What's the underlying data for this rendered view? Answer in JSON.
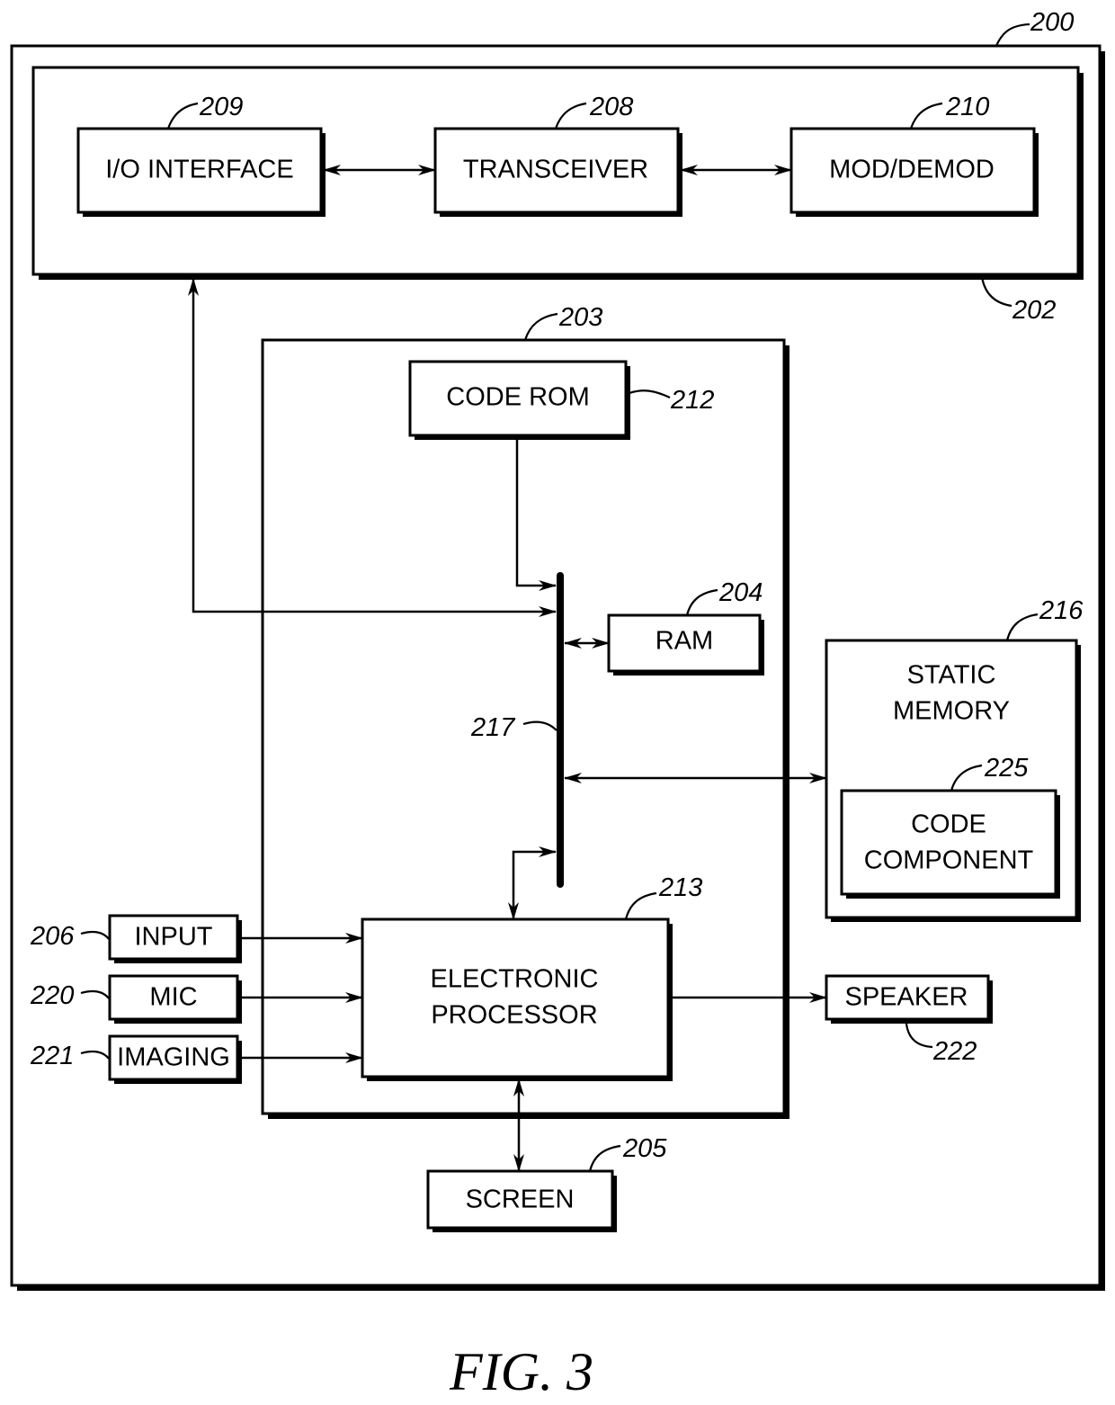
{
  "figure": {
    "caption": "FIG. 3",
    "refs": {
      "device": "200",
      "comm_unit": "202",
      "processing_unit": "203",
      "ram": "204",
      "screen": "205",
      "input": "206",
      "transceiver": "208",
      "io_interface": "209",
      "mod_demod": "210",
      "code_rom": "212",
      "processor": "213",
      "static_memory": "216",
      "bus": "217",
      "mic": "220",
      "imaging": "221",
      "speaker": "222",
      "code_component": "225"
    },
    "blocks": {
      "io_interface": "I/O INTERFACE",
      "transceiver": "TRANSCEIVER",
      "mod_demod": "MOD/DEMOD",
      "code_rom": "CODE ROM",
      "ram": "RAM",
      "static_memory_line1": "STATIC",
      "static_memory_line2": "MEMORY",
      "code_component_line1": "CODE",
      "code_component_line2": "COMPONENT",
      "input": "INPUT",
      "mic": "MIC",
      "imaging": "IMAGING",
      "processor_line1": "ELECTRONIC",
      "processor_line2": "PROCESSOR",
      "speaker": "SPEAKER",
      "screen": "SCREEN"
    }
  }
}
